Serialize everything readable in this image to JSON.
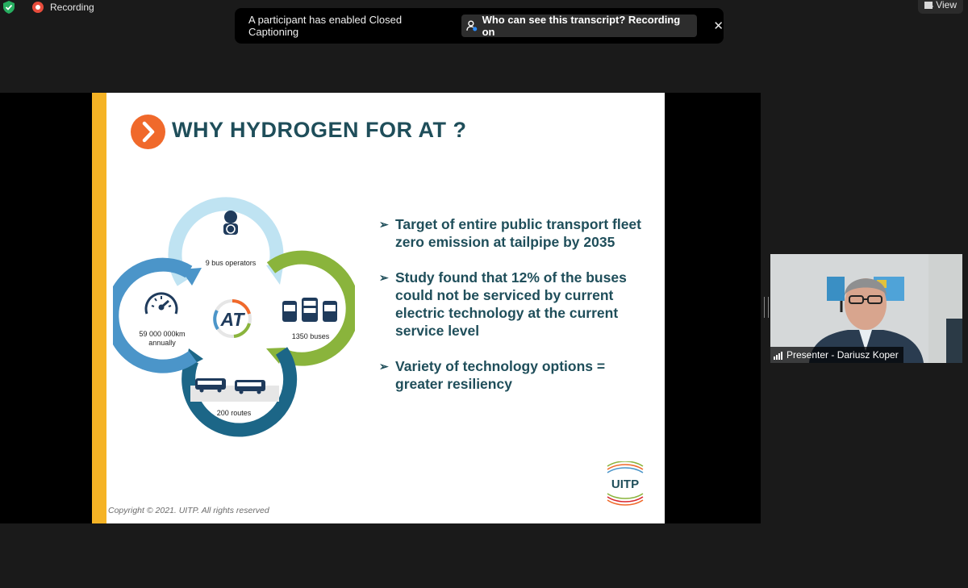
{
  "meeting": {
    "recording_label": "Recording",
    "view_label": "View"
  },
  "caption_banner": {
    "message": "A participant has enabled Closed Captioning",
    "transcript_link": "Who can see this transcript? Recording on",
    "close_glyph": "✕"
  },
  "slide": {
    "title": "WHY HYDROGEN FOR AT ?",
    "accent_color": "#f5b325",
    "title_color": "#1f4e5a",
    "diagram": {
      "center_logo": "AT",
      "items": [
        {
          "label": "9 bus operators",
          "icon": "driver-icon",
          "color": "#bfe3f2"
        },
        {
          "label": "1350 buses",
          "icon": "buses-icon",
          "color": "#8ab43c"
        },
        {
          "label": "200 routes",
          "icon": "route-buses-icon",
          "color": "#1c6687"
        },
        {
          "label_line1": "59 000 000km",
          "label_line2": "annually",
          "icon": "speedometer-icon",
          "color": "#4b95c9"
        }
      ]
    },
    "bullets": [
      "Target of entire public transport fleet zero emission at tailpipe by 2035",
      "Study found that 12% of the buses could not be serviced by current electric technology at the current service level",
      "Variety of technology options = greater resiliency"
    ],
    "copyright": "Copyright © 2021. UITP. All rights reserved",
    "logo_text": "UITP"
  },
  "participant": {
    "name": "Presenter - Dariusz Koper"
  }
}
